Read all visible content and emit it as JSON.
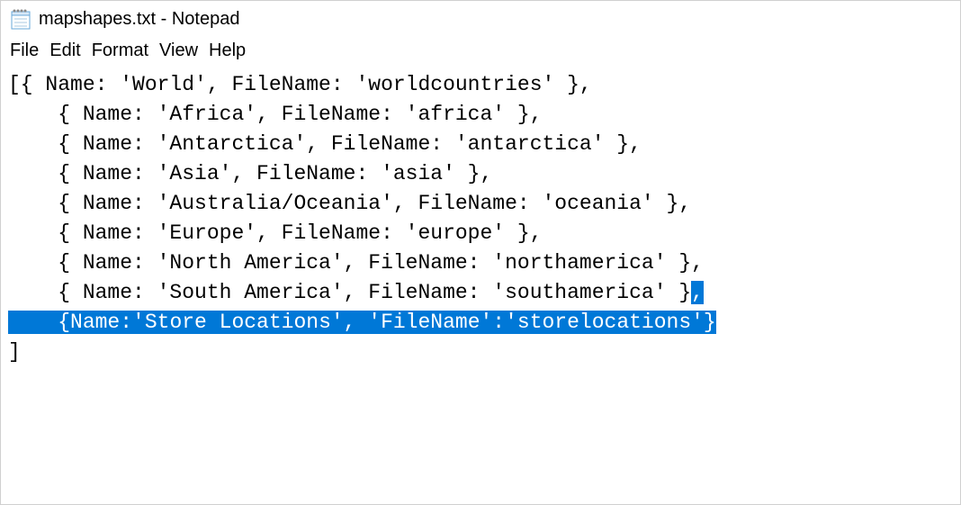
{
  "titlebar": {
    "text": "mapshapes.txt - Notepad"
  },
  "menu": {
    "file": "File",
    "edit": "Edit",
    "format": "Format",
    "view": "View",
    "help": "Help"
  },
  "editor": {
    "line1": "[{ Name: 'World', FileName: 'worldcountries' },",
    "line2": "    { Name: 'Africa', FileName: 'africa' },",
    "line3": "    { Name: 'Antarctica', FileName: 'antarctica' },",
    "line4": "    { Name: 'Asia', FileName: 'asia' },",
    "line5": "    { Name: 'Australia/Oceania', FileName: 'oceania' },",
    "line6": "    { Name: 'Europe', FileName: 'europe' },",
    "line7": "    { Name: 'North America', FileName: 'northamerica' },",
    "line8_pre": "    { Name: 'South America', FileName: 'southamerica' }",
    "line8_sel": ",",
    "line9_sel_pre": "    ",
    "line9_sel": "{Name:'Store Locations', 'FileName':'storelocations'}",
    "line10": "]"
  }
}
